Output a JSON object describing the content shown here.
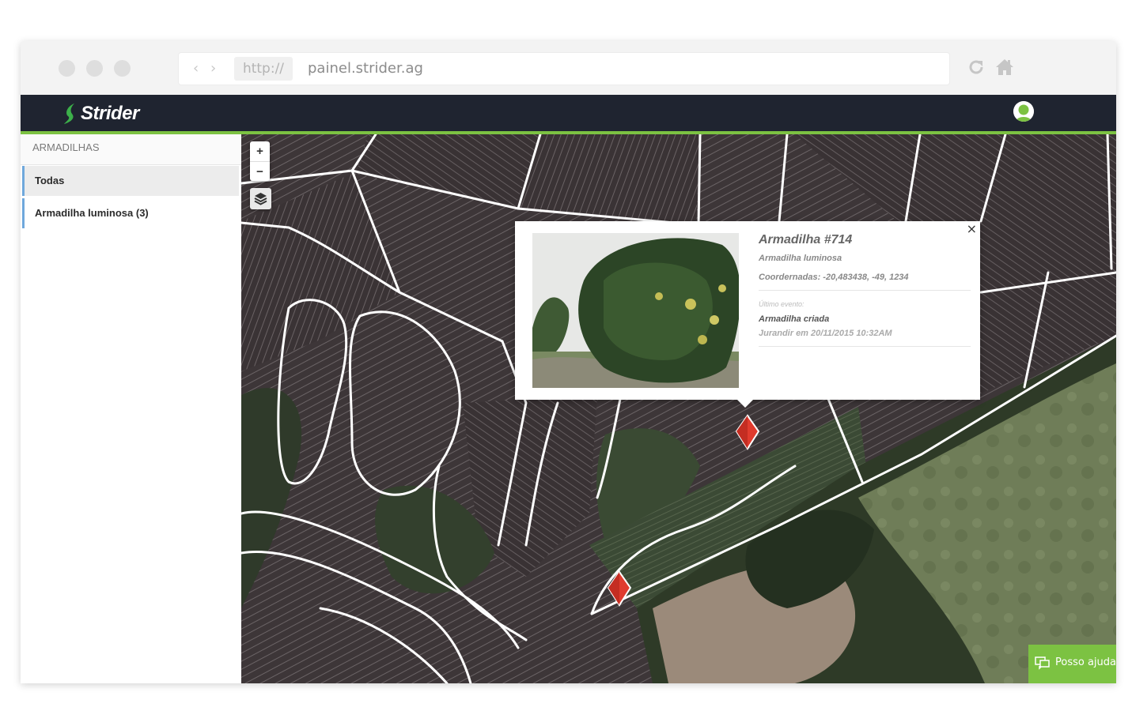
{
  "browser": {
    "protocol": "http://",
    "url": "painel.strider.ag",
    "icons": [
      "back-arrow-icon",
      "forward-arrow-icon",
      "reload-icon",
      "home-icon"
    ]
  },
  "app": {
    "brand": "Strider",
    "accent_color": "#7cc242",
    "header_color": "#1f2430"
  },
  "sidebar": {
    "title": "ARMADILHAS",
    "items": [
      {
        "label": "Todas",
        "active": true
      },
      {
        "label": "Armadilha luminosa (3)",
        "active": false
      }
    ]
  },
  "map": {
    "zoom_in": "+",
    "zoom_out": "−",
    "marker_color": "#e03b2e",
    "popup": {
      "title": "Armadilha #714",
      "type": "Armadilha luminosa",
      "coordinates": "Coordernadas: -20,483438, -49, 1234",
      "last_event_label": "Último evento",
      "last_event_colon": ":",
      "event": "Armadilha criada",
      "meta": "Jurandir em 20/11/2015 10:32AM",
      "close": "×"
    }
  },
  "help": {
    "label": "Posso ajudar?"
  }
}
